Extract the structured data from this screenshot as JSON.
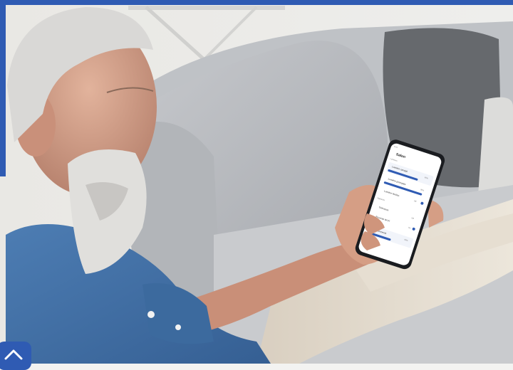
{
  "photo": {
    "subject": "photo",
    "phone_screen": {
      "status_time": "9:41",
      "title": "Salon",
      "section_1": "Lumières",
      "items": [
        {
          "label": "Lumière canapé",
          "value": "60%"
        },
        {
          "label": "Lumière principale",
          "value": "80%"
        },
        {
          "label": "Lumière fenêtre",
          "value": "Off"
        }
      ],
      "section_2": "Appareils",
      "devices": [
        {
          "label": "Télévision",
          "value": "Off"
        },
        {
          "label": "Enceinte Wi-Fi",
          "value": "On"
        },
        {
          "label": "Store connecté",
          "value": "50%"
        }
      ]
    }
  },
  "scroll_top_button": {
    "icon": "chevron-up-icon"
  },
  "colors": {
    "accent": "#2f5bb3",
    "sofa": "#b9bcc2",
    "shirt": "#3f6fa8"
  }
}
